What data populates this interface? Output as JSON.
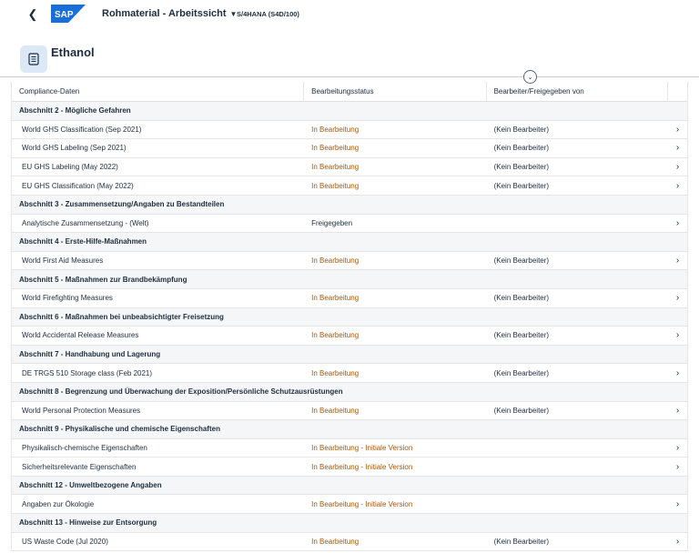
{
  "shell": {
    "back_icon": "chevron-left-icon",
    "logo_text": "SAP",
    "app_title": "Rohmaterial - Arbeitssicht",
    "system_id": "S/4HANA (S4D/100)",
    "brand_color": "#1a6ed8"
  },
  "header": {
    "object_icon": "document-icon",
    "title": "Ethanol"
  },
  "table": {
    "columns": [
      "Compliance-Daten",
      "Bearbeitungsstatus",
      "Bearbeiter/Freigegeben von"
    ],
    "groups": [
      {
        "title": "Abschnitt 2 - Mögliche Gefahren",
        "rows": [
          {
            "name": "World GHS Classification (Sep 2021)",
            "status": "In Bearbeitung",
            "editor": "(Kein Bearbeiter)"
          },
          {
            "name": "World GHS Labeling (Sep 2021)",
            "status": "In Bearbeitung",
            "editor": "(Kein Bearbeiter)"
          },
          {
            "name": "EU GHS Labeling (May 2022)",
            "status": "In Bearbeitung",
            "editor": "(Kein Bearbeiter)"
          },
          {
            "name": "EU GHS Classification (May 2022)",
            "status": "In Bearbeitung",
            "editor": "(Kein Bearbeiter)"
          }
        ]
      },
      {
        "title": "Abschnitt 3 - Zusammensetzung/Angaben zu Bestandteilen",
        "rows": [
          {
            "name": "Analytische Zusammensetzung - (Welt)",
            "status": "Freigegeben",
            "editor": ""
          }
        ]
      },
      {
        "title": "Abschnitt 4 - Erste-Hilfe-Maßnahmen",
        "rows": [
          {
            "name": "World First Aid Measures",
            "status": "In Bearbeitung",
            "editor": "(Kein Bearbeiter)"
          }
        ]
      },
      {
        "title": "Abschnitt 5 - Maßnahmen zur Brandbekämpfung",
        "rows": [
          {
            "name": "World Firefighting Measures",
            "status": "In Bearbeitung",
            "editor": "(Kein Bearbeiter)"
          }
        ]
      },
      {
        "title": "Abschnitt 6 - Maßnahmen bei unbeabsichtigter Freisetzung",
        "rows": [
          {
            "name": "World Accidental Release Measures",
            "status": "In Bearbeitung",
            "editor": "(Kein Bearbeiter)"
          }
        ]
      },
      {
        "title": "Abschnitt 7 - Handhabung und Lagerung",
        "rows": [
          {
            "name": "DE TRGS 510 Storage class (Feb 2021)",
            "status": "In Bearbeitung",
            "editor": "(Kein Bearbeiter)"
          }
        ]
      },
      {
        "title": "Abschnitt 8 - Begrenzung und Überwachung der Exposition/Persönliche Schutzausrüstungen",
        "rows": [
          {
            "name": "World Personal Protection Measures",
            "status": "In Bearbeitung",
            "editor": "(Kein Bearbeiter)"
          }
        ]
      },
      {
        "title": "Abschnitt 9 - Physikalische und chemische Eigenschaften",
        "rows": [
          {
            "name": "Physikalisch-chemische Eigenschaften",
            "status": "In Bearbeitung - Initiale Version",
            "editor": ""
          },
          {
            "name": "Sicherheitsrelevante Eigenschaften",
            "status": "In Bearbeitung - Initiale Version",
            "editor": ""
          }
        ]
      },
      {
        "title": "Abschnitt 12 - Umweltbezogene Angaben",
        "rows": [
          {
            "name": "Angaben zur Ökologie",
            "status": "In Bearbeitung - Initiale Version",
            "editor": ""
          }
        ]
      },
      {
        "title": "Abschnitt 13 - Hinweise zur Entsorgung",
        "rows": [
          {
            "name": "US Waste Code (Jul 2020)",
            "status": "In Bearbeitung",
            "editor": "(Kein Bearbeiter)"
          }
        ]
      }
    ],
    "status_colors": {
      "in_progress": "#a6560a",
      "released": "#1d2d3e"
    },
    "row_nav_icon": "chevron-right-icon"
  }
}
